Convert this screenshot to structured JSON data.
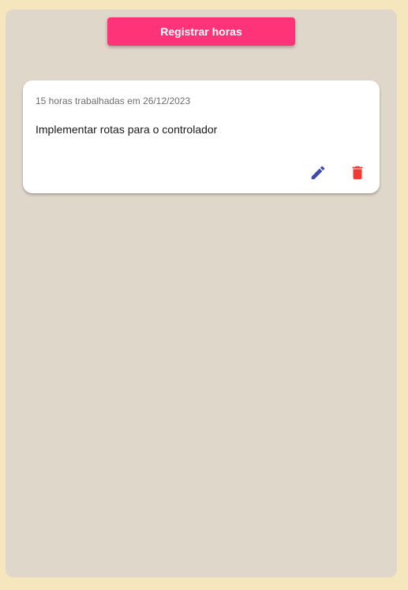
{
  "toolbar": {
    "register_label": "Registrar horas",
    "accent_color": "#ff3377"
  },
  "entries": [
    {
      "meta": "15 horas trabalhadas em 26/12/2023",
      "description": "Implementar rotas para o controlador",
      "actions": {
        "edit_icon": "pencil-icon",
        "edit_color": "#3f4aa8",
        "delete_icon": "trash-icon",
        "delete_color": "#f23a32"
      }
    }
  ]
}
